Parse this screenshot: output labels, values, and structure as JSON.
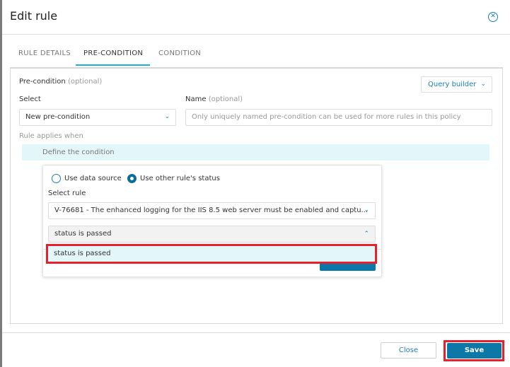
{
  "dialog": {
    "title": "Edit rule",
    "close_icon": "close-circle-icon"
  },
  "tabs": [
    {
      "label": "RULE DETAILS"
    },
    {
      "label": "PRE-CONDITION",
      "active": true
    },
    {
      "label": "CONDITION"
    }
  ],
  "precondition": {
    "heading": "Pre-condition",
    "heading_hint": "(optional)",
    "query_builder_label": "Query builder",
    "select_label": "Select",
    "select_value": "New pre-condition",
    "name_label": "Name",
    "name_hint": "(optional)",
    "name_placeholder": "Only uniquely named pre-condition can be used for more rules in this policy",
    "applies_label": "Rule applies when",
    "define_label": "Define the condition"
  },
  "popup": {
    "radio_data_source": "Use data source",
    "radio_other_rule": "Use other rule's status",
    "selected_radio": "Use other rule's status",
    "select_rule_label": "Select rule",
    "rule_value": "V-76681 - The enhanced logging for the IIS 8.5 web server must be enabled and captu...",
    "status_value": "status is passed",
    "status_options": [
      "status is passed"
    ]
  },
  "footer": {
    "close_label": "Close",
    "save_label": "Save"
  },
  "colors": {
    "accent": "#0b78a8",
    "tab_underline": "#1ab3c9",
    "highlight": "#e3f6fa",
    "annotation": "#e8202a"
  }
}
